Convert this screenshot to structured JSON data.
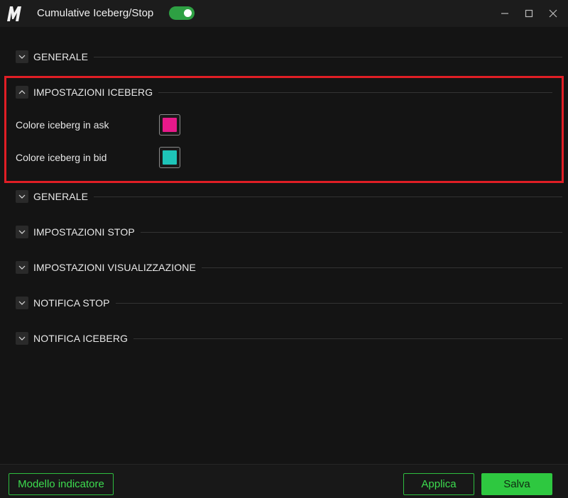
{
  "window": {
    "title": "Cumulative Iceberg/Stop",
    "toggle_on": true,
    "accent": "#2ea043"
  },
  "sections_top": [
    {
      "label": "GENERALE",
      "expanded": false
    }
  ],
  "iceberg_section": {
    "label": "IMPOSTAZIONI ICEBERG",
    "expanded": true,
    "rows": [
      {
        "label": "Colore iceberg in ask",
        "color": "#e8198a"
      },
      {
        "label": "Colore iceberg in bid",
        "color": "#1ec4b8"
      }
    ]
  },
  "sections_bottom": [
    {
      "label": "GENERALE",
      "expanded": false
    },
    {
      "label": "IMPOSTAZIONI STOP",
      "expanded": false
    },
    {
      "label": "IMPOSTAZIONI VISUALIZZAZIONE",
      "expanded": false
    },
    {
      "label": "NOTIFICA STOP",
      "expanded": false
    },
    {
      "label": "NOTIFICA ICEBERG",
      "expanded": false
    }
  ],
  "footer": {
    "template_label": "Modello indicatore",
    "apply_label": "Applica",
    "save_label": "Salva"
  },
  "highlight_color": "#e01e25"
}
